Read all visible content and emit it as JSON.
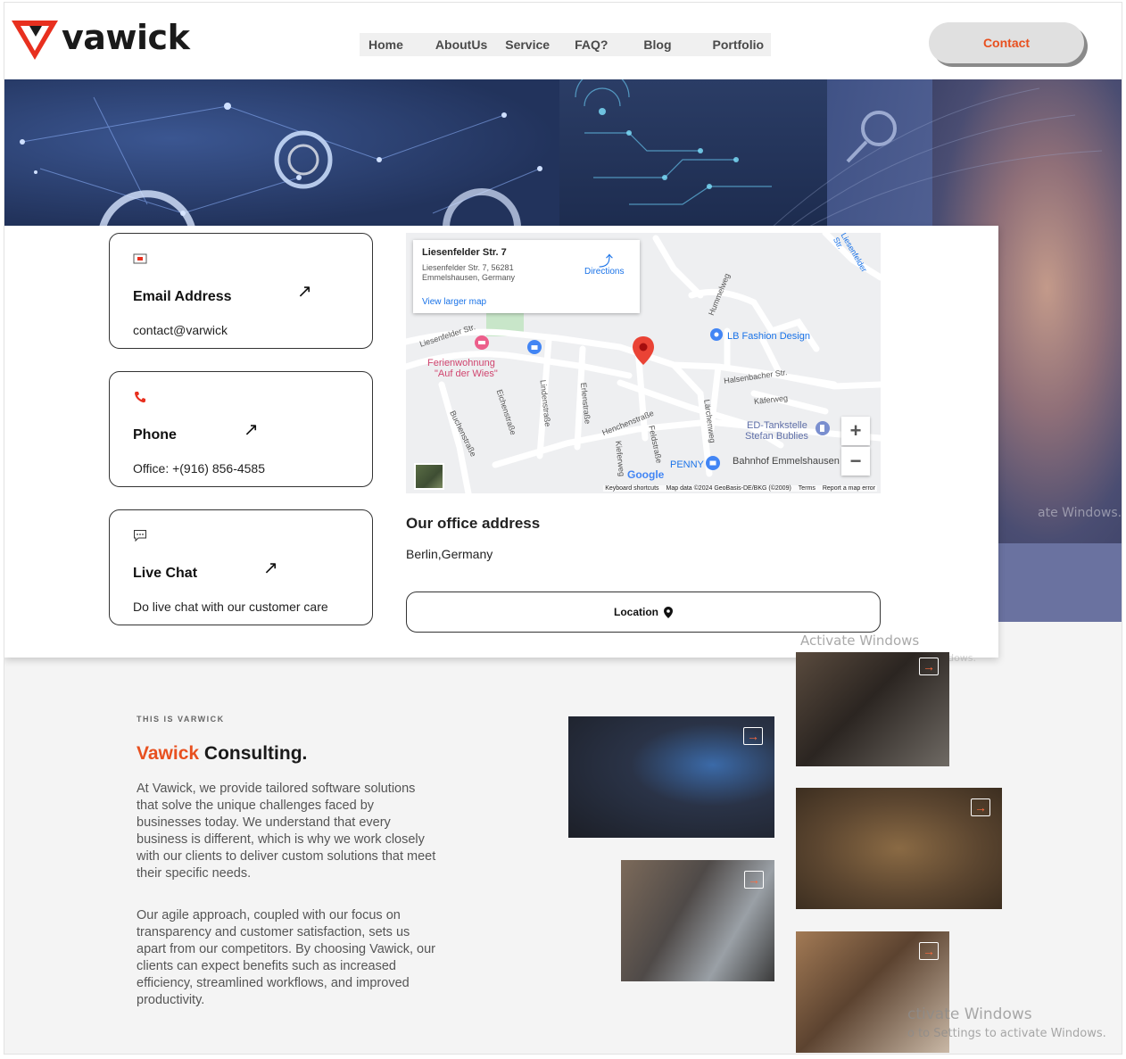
{
  "header": {
    "brand": "vawick",
    "nav": [
      "Home",
      "AboutUs",
      "Service",
      "FAQ?",
      "Blog",
      "Portfolio"
    ],
    "contact_label": "Contact"
  },
  "cards": [
    {
      "title": "Email Address",
      "text": "contact@varwick",
      "icon": "envelope-icon"
    },
    {
      "title": "Phone",
      "text": "Office: +(916) 856-4585",
      "icon": "phone-icon"
    },
    {
      "title": "Live Chat",
      "text": "Do live chat with our customer care",
      "icon": "chat-icon"
    }
  ],
  "map": {
    "place_title": "Liesenfelder Str. 7",
    "place_address": "Liesenfelder Str. 7, 56281 Emmelshausen, Germany",
    "directions": "Directions",
    "larger_map": "View larger map",
    "labels": [
      "Liesenfelder Str.",
      "Liesenfelder Str.",
      "LB Fashion Design",
      "Ferienwohnung",
      "\"Auf der Wies\"",
      "Halsenbacher Str.",
      "Käferweg",
      "ED-Tankstelle",
      "Stefan Bublies",
      "Bahnhof Emmelshausen",
      "PENNY",
      "Henchenstraße",
      "Feldstraße",
      "Kieferweg",
      "Lindenstraße",
      "Erlenstraße",
      "Eichenstraße",
      "Buchenstraße",
      "Lärchenweg",
      "Hummelweg",
      "Google"
    ],
    "footer": [
      "Keyboard shortcuts",
      "Map data ©2024 GeoBasis-DE/BKG (©2009)",
      "Terms",
      "Report a map error"
    ]
  },
  "office": {
    "title": "Our office address",
    "city": "Berlin,Germany",
    "location_button": "Location"
  },
  "about": {
    "eyebrow": "THIS IS VARWICK",
    "title_accent": "Vawick",
    "title_rest": " Consulting.",
    "para1": "At Vawick, we provide tailored software solutions that solve the unique challenges faced by businesses today. We understand that every business is different, which is why we work closely with our clients to deliver custom solutions that meet their specific needs.",
    "para2": "Our agile approach, coupled with our focus on transparency and customer satisfaction, sets us apart from our competitors. By choosing Vawick, our clients can expect benefits such as increased efficiency, streamlined workflows, and improved productivity."
  },
  "watermarks": {
    "activate": "Activate Windows",
    "goto": "Go to Settings to activate Windows.",
    "hero_fragment": "ate Windows.",
    "bottom_activate": "ctivate Windows",
    "bottom_goto": "o to Settings to activate Windows."
  },
  "colors": {
    "accent": "#e8501f",
    "dark": "#1a1a1a",
    "hero": "#2a3960"
  }
}
